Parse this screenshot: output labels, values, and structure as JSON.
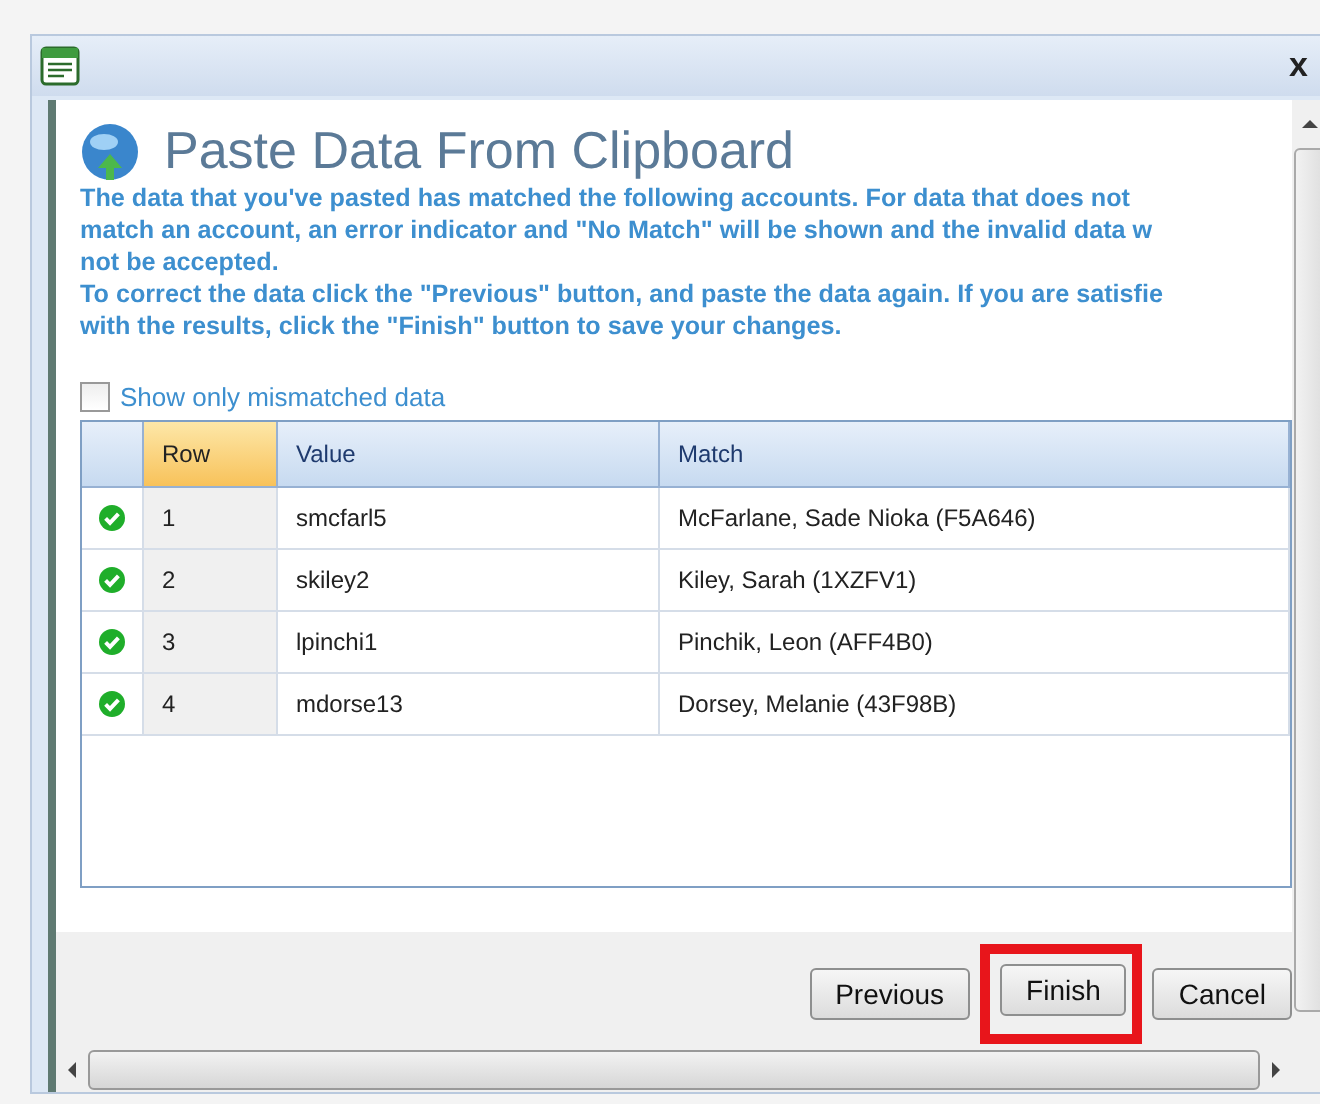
{
  "window": {
    "close_label": "x"
  },
  "heading": "Paste Data From Clipboard",
  "instructions": [
    "The data that you've pasted has matched the following accounts. For data that does not",
    "match an account, an error indicator and \"No Match\" will be shown and the invalid data w",
    "not be accepted.",
    "To correct the data click the \"Previous\" button, and paste the data again. If you are satisfie",
    "with the results, click the \"Finish\" button to save your changes."
  ],
  "filter": {
    "label": "Show only mismatched data",
    "checked": false
  },
  "table": {
    "columns": [
      {
        "label": "Row",
        "sorted": true
      },
      {
        "label": "Value",
        "sorted": false
      },
      {
        "label": "Match",
        "sorted": false
      }
    ],
    "rows": [
      {
        "matched": true,
        "cells": [
          "1",
          "smcfarl5",
          "McFarlane, Sade Nioka (F5A646)"
        ]
      },
      {
        "matched": true,
        "cells": [
          "2",
          "skiley2",
          "Kiley, Sarah (1XZFV1)"
        ]
      },
      {
        "matched": true,
        "cells": [
          "3",
          "lpinchi1",
          "Pinchik, Leon (AFF4B0)"
        ]
      },
      {
        "matched": true,
        "cells": [
          "4",
          "mdorse13",
          "Dorsey, Melanie (43F98B)"
        ]
      }
    ]
  },
  "buttons": [
    {
      "label": "Previous",
      "highlighted": false
    },
    {
      "label": "Finish",
      "highlighted": true
    },
    {
      "label": "Cancel",
      "highlighted": false
    }
  ]
}
